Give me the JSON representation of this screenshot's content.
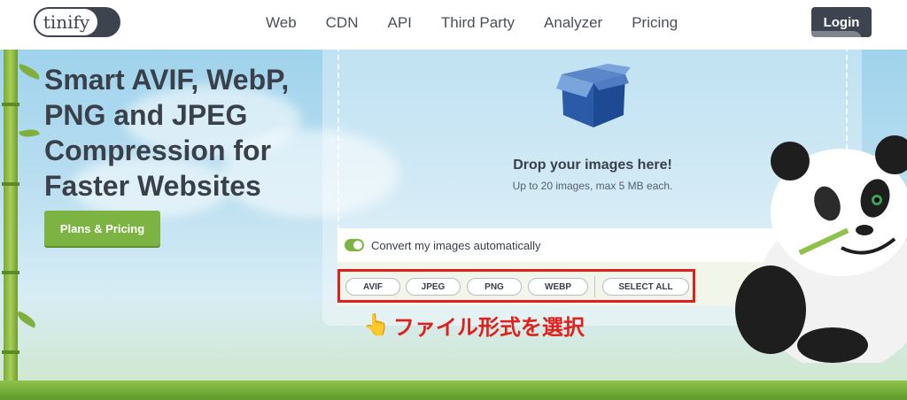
{
  "header": {
    "logo_text": "tinify",
    "nav": [
      "Web",
      "CDN",
      "API",
      "Third Party",
      "Analyzer",
      "Pricing"
    ],
    "login_label": "Login"
  },
  "hero": {
    "headline": "Smart AVIF, WebP, PNG and JPEG Compression for Faster Websites",
    "plans_button": "Plans & Pricing"
  },
  "upload": {
    "drop_title": "Drop your images here!",
    "drop_subtitle": "Up to 20 images, max 5 MB each.",
    "convert_label": "Convert my images automatically",
    "convert_enabled": true,
    "formats": [
      "AVIF",
      "JPEG",
      "PNG",
      "WEBP"
    ],
    "select_all_label": "SELECT ALL"
  },
  "annotation": {
    "text": "ファイル形式を選択",
    "icon": "pointing-hand-icon",
    "color": "#e0201c"
  },
  "colors": {
    "brand_dark": "#3d4450",
    "accent_green": "#7cb342",
    "highlight_red": "#e0201c"
  }
}
